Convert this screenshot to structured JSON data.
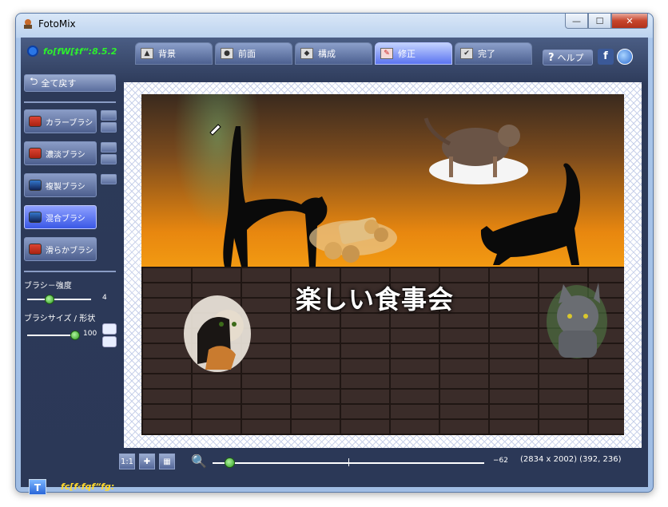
{
  "window": {
    "title": "FotoMix"
  },
  "window_controls": {
    "minimize": "—",
    "maximize": "☐",
    "close": "✕"
  },
  "version_text": "fo[fW[‡f“:8.5.2",
  "tabs": [
    {
      "label": "背景",
      "active": false
    },
    {
      "label": "前面",
      "active": false
    },
    {
      "label": "構成",
      "active": false
    },
    {
      "label": "修正",
      "active": true
    },
    {
      "label": "完了",
      "active": false
    }
  ],
  "help": {
    "label": "ヘルプ",
    "icon": "?"
  },
  "facebook": {
    "label": "f"
  },
  "sidebar": {
    "reset_label": "全て戻す",
    "brushes": [
      {
        "label": "カラーブラシ",
        "active": false
      },
      {
        "label": "濃淡ブラシ",
        "active": false
      },
      {
        "label": "複製ブラシ",
        "active": false
      },
      {
        "label": "混合ブラシ",
        "active": true
      },
      {
        "label": "滑らかブラシ",
        "active": false
      }
    ],
    "brush_strength_label": "ブラシ－強度",
    "brush_strength_value": "4",
    "brush_size_label": "ブラシサイズ / 形状",
    "brush_size_value": "100"
  },
  "canvas_text": "楽しい食事会",
  "bottombar": {
    "btn_1to1": "1:1",
    "btn_fit": "✚",
    "btn_grid": "▦",
    "zoom_value": "−62",
    "dimensions": "(2834 x 2002) (392, 236)"
  },
  "text_tool_label": "T",
  "status_text": "fc[f‹fqf“fg:",
  "colors": {
    "active_tab": "#5b74f0",
    "version_green": "#2df02d",
    "status_yellow": "#ffd92d"
  }
}
